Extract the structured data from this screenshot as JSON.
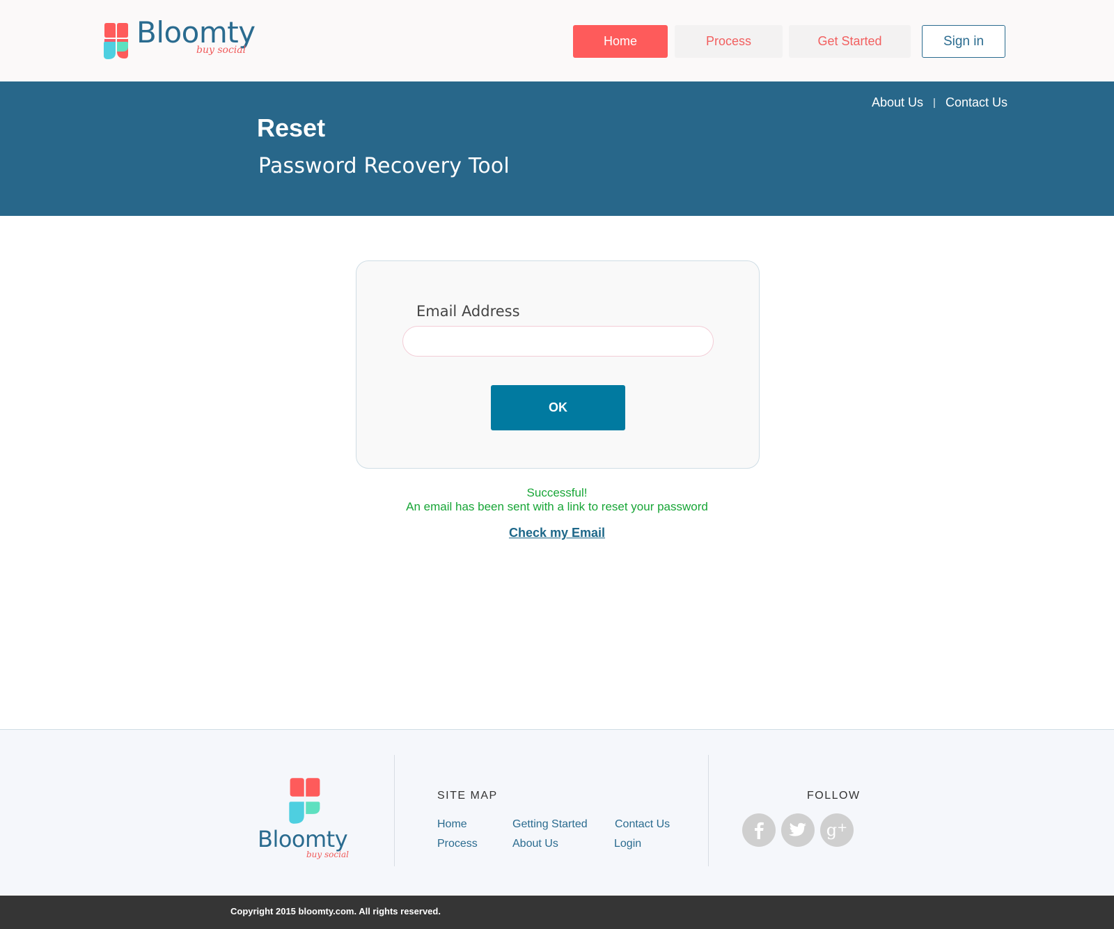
{
  "brand": {
    "name": "Bloomty",
    "tagline": "buy social",
    "colors": {
      "coral": "#fe5b5b",
      "teal": "#4ecfe0",
      "mint": "#5ee0c0",
      "navy": "#2a6b8f"
    }
  },
  "nav": {
    "home": "Home",
    "process": "Process",
    "get_started": "Get Started",
    "sign_in": "Sign in"
  },
  "banner": {
    "about": "About Us",
    "separator": "|",
    "contact": "Contact Us",
    "title": "Reset",
    "subtitle": "Password Recovery Tool",
    "bg_color": "#28678a"
  },
  "form": {
    "email_label": "Email Address",
    "email_value": "",
    "email_placeholder": "",
    "ok_label": "OK",
    "ok_color": "#017aa0"
  },
  "status": {
    "title": "Successful!",
    "message": "An email has been sent with a link to reset your password",
    "link": "Check my Email",
    "color": "#17a536"
  },
  "footer": {
    "sitemap_title": "SITE MAP",
    "sitemap_links": [
      "Home",
      "Getting Started",
      "Contact Us",
      "Process",
      "About Us",
      "Login"
    ],
    "follow_title": "FOLLOW",
    "social_icons": [
      "facebook-icon",
      "twitter-icon",
      "google-plus-icon"
    ],
    "copyright": "Copyright 2015 bloomty.com. All rights reserved."
  }
}
